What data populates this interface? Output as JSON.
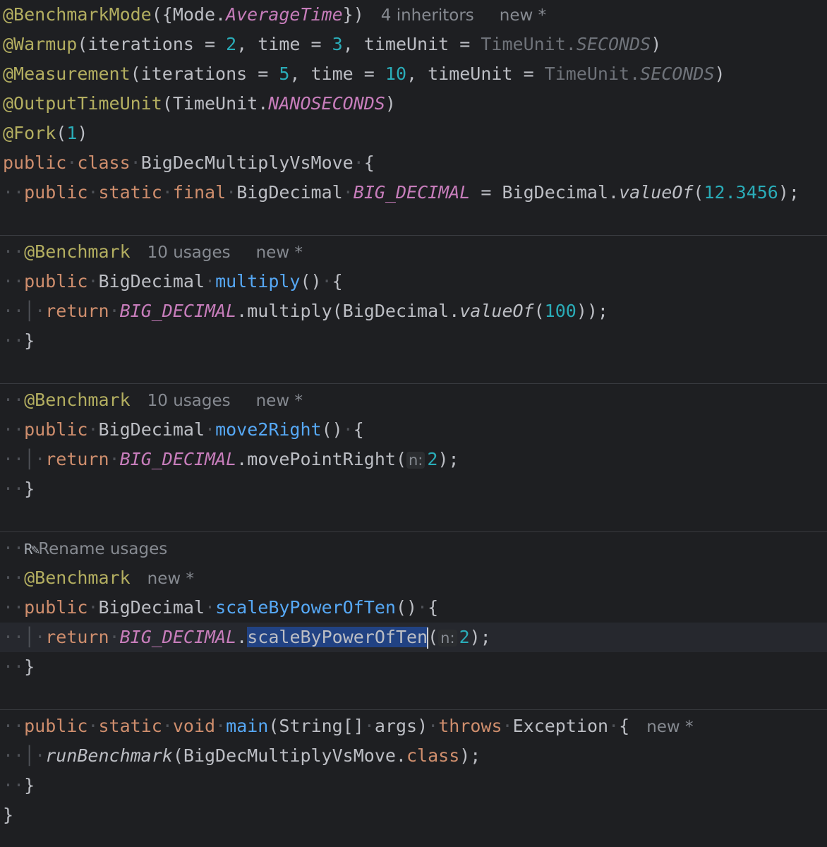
{
  "hints": {
    "inheritors": "4 inheritors",
    "new": "new *",
    "usages": "10 usages",
    "rename_usages": "Rename usages"
  },
  "code": {
    "ann_mode": "@BenchmarkMode",
    "mode_open": "({Mode.",
    "average_time": "AverageTime",
    "mode_close": "})",
    "ann_warmup": "@Warmup",
    "open_iterations": "(iterations",
    "eq": " = ",
    "warmup_iterations": "2",
    "comma_time": ", time",
    "warmup_time": "3",
    "comma_timeunit": ", timeUnit",
    "timeunit_class": "TimeUnit.",
    "seconds": "SECONDS",
    "close_paren": ")",
    "ann_measurement": "@Measurement",
    "measurement_iterations": "5",
    "measurement_time": "10",
    "ann_output": "@OutputTimeUnit",
    "output_open": "(TimeUnit.",
    "nanoseconds": "NANOSECONDS",
    "ann_fork": "@Fork",
    "open_paren": "(",
    "fork_value": "1",
    "kw_public": "public",
    "kw_class": "class",
    "class_name": "BigDecMultiplyVsMove",
    "brace_open": "{",
    "brace_close": "}",
    "kw_static": "static",
    "kw_final": "final",
    "type_bigdecimal": "BigDecimal",
    "const_name": "BIG_DECIMAL",
    "eq_bigdecimal": " = BigDecimal.",
    "valueof": "valueOf",
    "const_value": "12.3456",
    "close_semicolon": ");",
    "ann_benchmark": "@Benchmark",
    "method_multiply": "multiply",
    "parens": "()",
    "kw_return": "return",
    "multiply_call": ".multiply(BigDecimal.",
    "multiply_arg": "100",
    "close_double": "));",
    "method_move": "move2Right",
    "move_call": ".movePointRight(",
    "param_hint": "n:",
    "move_arg": "2",
    "method_scale": "scaleByPowerOfTen",
    "dot": ".",
    "scale_arg": "2",
    "kw_void": "void",
    "method_main": "main",
    "main_params": "(String[]",
    "args_close": "args)",
    "kw_throws": "throws",
    "exception": "Exception",
    "run_benchmark": "runBenchmark",
    "run_arg": "(BigDecMultiplyVsMove.",
    "kw_class_lit": "class"
  }
}
